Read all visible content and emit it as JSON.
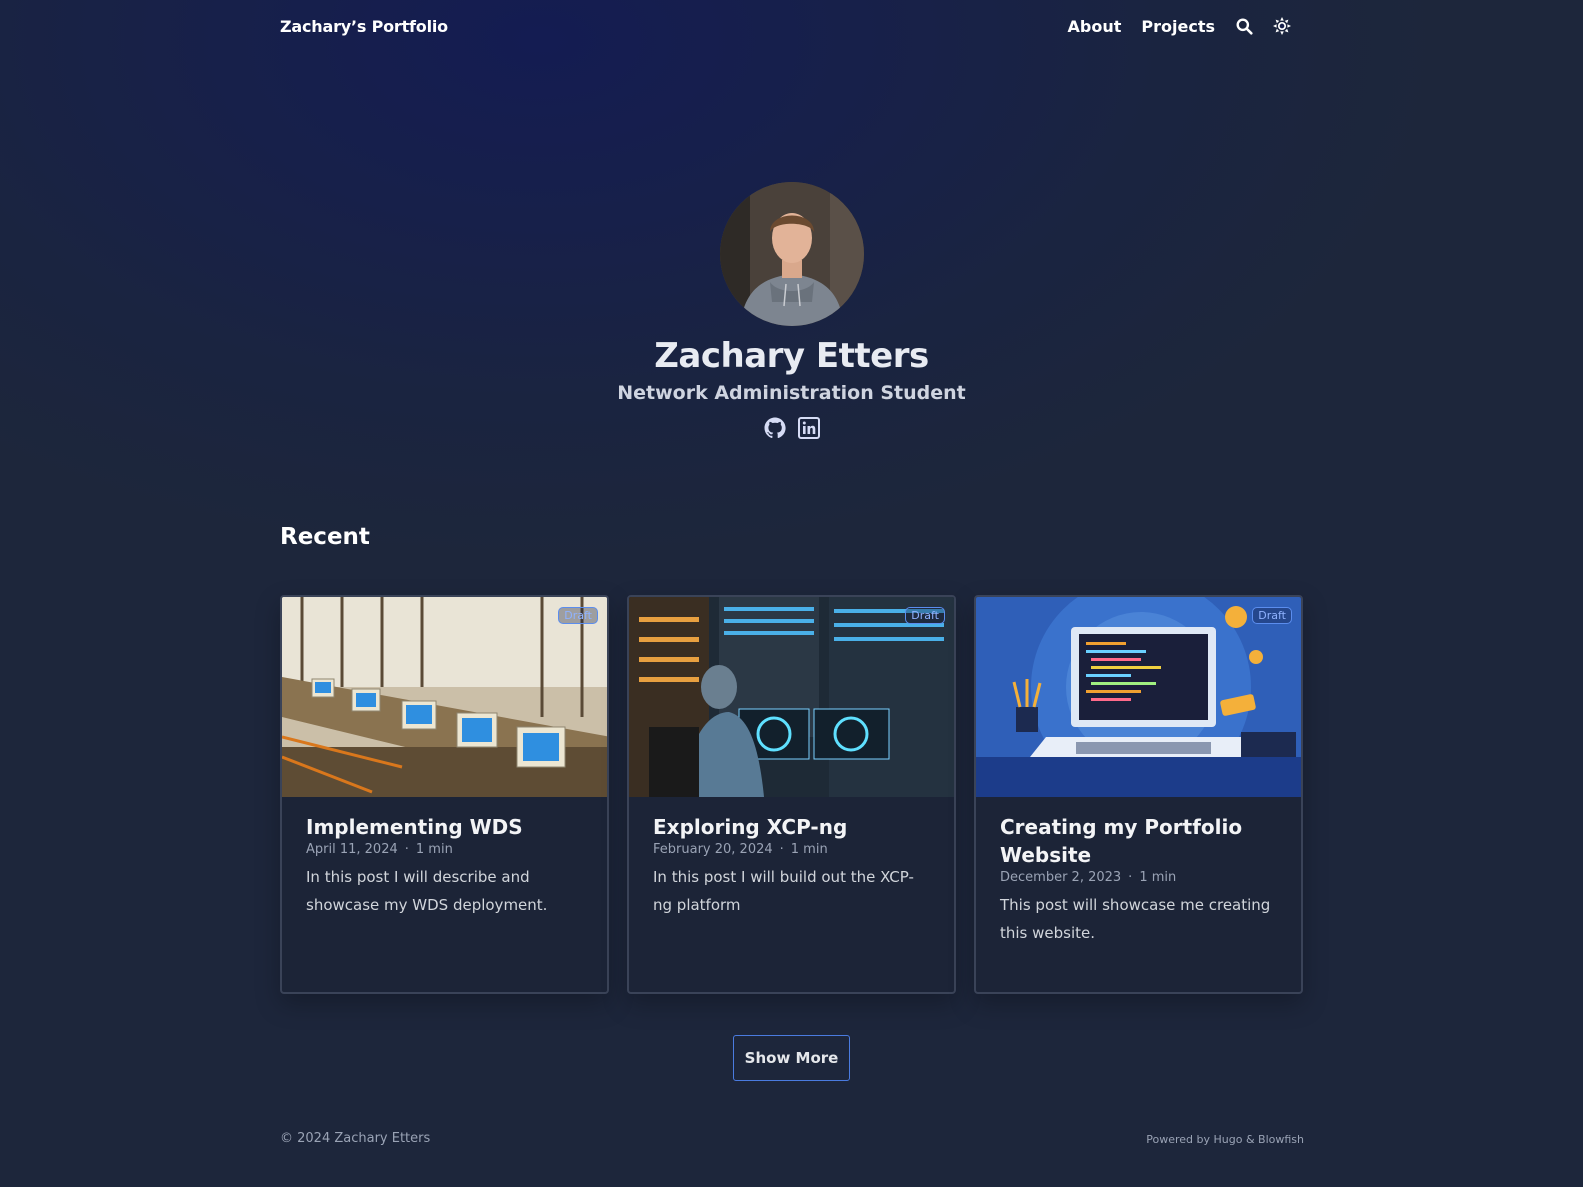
{
  "header": {
    "brand": "Zachary’s Portfolio",
    "nav": [
      "About",
      "Projects"
    ]
  },
  "hero": {
    "name": "Zachary Etters",
    "subtitle": "Network Administration Student"
  },
  "section_title": "Recent",
  "cards": [
    {
      "title": "Implementing WDS",
      "date": "April 11, 2024",
      "read_time": "1 min",
      "description": "In this post I will describe and showcase my WDS deployment.",
      "badge": "Draft"
    },
    {
      "title": "Exploring XCP-ng",
      "date": "February 20, 2024",
      "read_time": "1 min",
      "description": "In this post I will build out the XCP-ng platform",
      "badge": "Draft"
    },
    {
      "title": "Creating my Portfolio Website",
      "date": "December 2, 2023",
      "read_time": "1 min",
      "description": "This post will showcase me creating this website.",
      "badge": "Draft"
    }
  ],
  "show_more": "Show More",
  "footer": {
    "copyright": "© 2024 Zachary Etters",
    "powered": "Powered by Hugo & Blowfish"
  },
  "dot": "·",
  "icons": [
    "search-icon",
    "sun-icon",
    "github-icon",
    "linkedin-icon"
  ],
  "colors": {
    "accent": "#4a7be0",
    "background": "#1d263b",
    "badge": "#8fb2ff"
  }
}
